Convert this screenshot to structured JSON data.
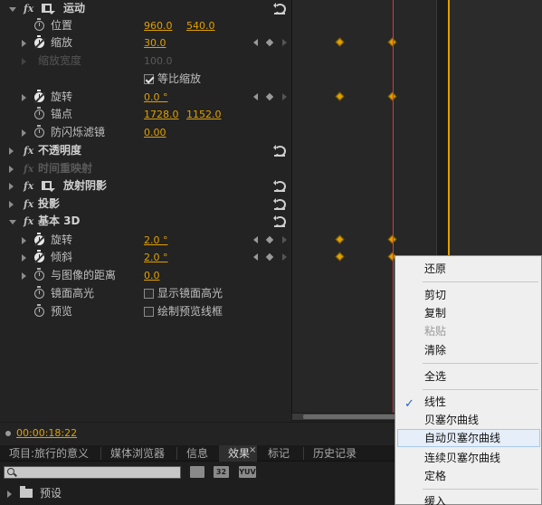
{
  "effect_controls": {
    "rows": [
      {
        "label": "运动",
        "section": true
      },
      {
        "label": "位置",
        "values": [
          "960.0",
          "540.0"
        ]
      },
      {
        "label": "缩放",
        "values": [
          "30.0"
        ]
      },
      {
        "label": "缩放宽度",
        "values": [
          "100.0"
        ],
        "disabled": true
      },
      {
        "checkbox_label": "等比缩放",
        "checked": true
      },
      {
        "label": "旋转",
        "values": [
          "0.0 °"
        ]
      },
      {
        "label": "锚点",
        "values": [
          "1728.0",
          "1152.0"
        ]
      },
      {
        "label": "防闪烁滤镜",
        "values": [
          "0.00"
        ]
      },
      {
        "label": "不透明度",
        "section": true
      },
      {
        "label": "时间重映射",
        "section": true,
        "disabled": true
      },
      {
        "label": "放射阴影",
        "section": true
      },
      {
        "label": "投影",
        "section": true
      },
      {
        "label": "基本 3D",
        "section": true
      },
      {
        "label": "旋转",
        "values": [
          "2.0 °"
        ]
      },
      {
        "label": "倾斜",
        "values": [
          "2.0 °"
        ]
      },
      {
        "label": "与图像的距离",
        "values": [
          "0.0"
        ]
      },
      {
        "label": "镜面高光",
        "checkbox_label": "显示镜面高光",
        "checked": false
      },
      {
        "label": "预览",
        "checkbox_label": "绘制预览线框",
        "checked": false
      }
    ],
    "fx_symbol": "fx",
    "timecode": "00:00:18:22",
    "colors": {
      "accent": "#e0a000",
      "playhead": "#d63a3a",
      "keyframe": "#e0a000"
    }
  },
  "bottom_panel": {
    "tabs": [
      {
        "label": "项目:旅行的意义"
      },
      {
        "label": "媒体浏览器"
      },
      {
        "label": "信息"
      },
      {
        "label": "效果",
        "active": true,
        "close": "×"
      },
      {
        "label": "标记"
      },
      {
        "label": "历史记录"
      }
    ],
    "search": {
      "placeholder": ""
    },
    "icon_labels": [
      "32",
      "YUV"
    ],
    "preset_label": "预设"
  },
  "context_menu": {
    "items": [
      {
        "label": "还原"
      },
      {
        "label": "剪切"
      },
      {
        "label": "复制"
      },
      {
        "label": "粘贴",
        "disabled": true
      },
      {
        "label": "清除"
      },
      {
        "label": "全选"
      },
      {
        "label": "线性",
        "checked": true,
        "check_glyph": "✓"
      },
      {
        "label": "贝塞尔曲线"
      },
      {
        "label": "自动贝塞尔曲线",
        "hover": true
      },
      {
        "label": "连续贝塞尔曲线"
      },
      {
        "label": "定格"
      },
      {
        "label": "缓入"
      }
    ]
  }
}
